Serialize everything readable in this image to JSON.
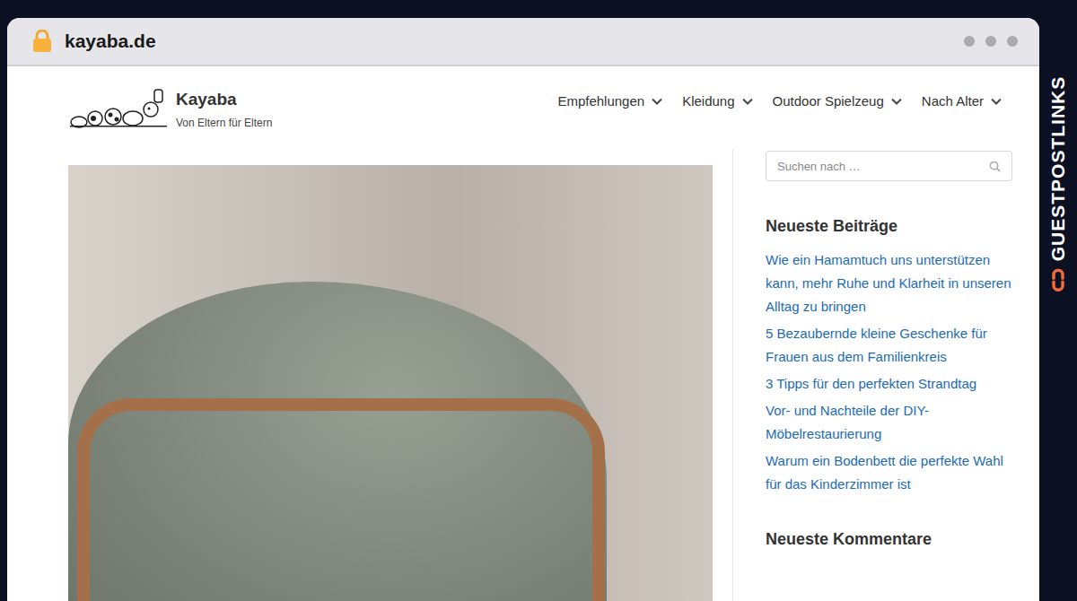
{
  "browser": {
    "url": "kayaba.de"
  },
  "site": {
    "title": "Kayaba",
    "tagline": "Von Eltern für Eltern"
  },
  "nav": [
    {
      "label": "Empfehlungen"
    },
    {
      "label": "Kleidung"
    },
    {
      "label": "Outdoor Spielzeug"
    },
    {
      "label": "Nach Alter"
    }
  ],
  "search": {
    "placeholder": "Suchen nach …"
  },
  "recent": {
    "title": "Neueste Beiträge",
    "items": [
      "Wie ein Hamamtuch uns unterstützen kann, mehr Ruhe und Klarheit in unseren Alltag zu bringen",
      "5 Bezaubernde kleine Geschenke für Frauen aus dem Familienkreis",
      "3 Tipps für den perfekten Strandtag",
      "Vor- und Nachteile der DIY-Möbelrestaurierung",
      "Warum ein Bodenbett die perfekte Wahl für das Kinderzimmer ist"
    ]
  },
  "comments": {
    "title": "Neueste Kommentare"
  },
  "brand": {
    "name": "GUESTPOSTLINKS"
  }
}
